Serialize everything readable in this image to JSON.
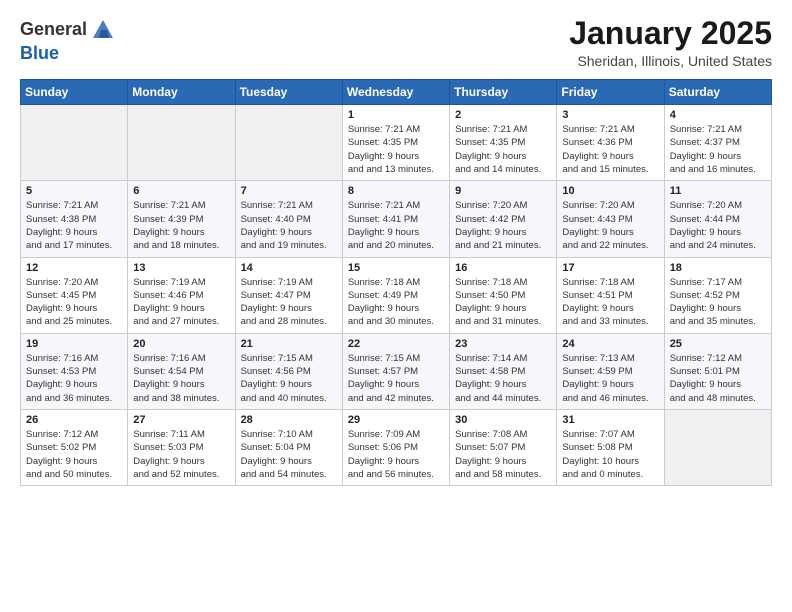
{
  "header": {
    "logo_general": "General",
    "logo_blue": "Blue",
    "month": "January 2025",
    "location": "Sheridan, Illinois, United States"
  },
  "weekdays": [
    "Sunday",
    "Monday",
    "Tuesday",
    "Wednesday",
    "Thursday",
    "Friday",
    "Saturday"
  ],
  "weeks": [
    [
      {
        "day": "",
        "info": ""
      },
      {
        "day": "",
        "info": ""
      },
      {
        "day": "",
        "info": ""
      },
      {
        "day": "1",
        "info": "Sunrise: 7:21 AM\nSunset: 4:35 PM\nDaylight: 9 hours and 13 minutes."
      },
      {
        "day": "2",
        "info": "Sunrise: 7:21 AM\nSunset: 4:35 PM\nDaylight: 9 hours and 14 minutes."
      },
      {
        "day": "3",
        "info": "Sunrise: 7:21 AM\nSunset: 4:36 PM\nDaylight: 9 hours and 15 minutes."
      },
      {
        "day": "4",
        "info": "Sunrise: 7:21 AM\nSunset: 4:37 PM\nDaylight: 9 hours and 16 minutes."
      }
    ],
    [
      {
        "day": "5",
        "info": "Sunrise: 7:21 AM\nSunset: 4:38 PM\nDaylight: 9 hours and 17 minutes."
      },
      {
        "day": "6",
        "info": "Sunrise: 7:21 AM\nSunset: 4:39 PM\nDaylight: 9 hours and 18 minutes."
      },
      {
        "day": "7",
        "info": "Sunrise: 7:21 AM\nSunset: 4:40 PM\nDaylight: 9 hours and 19 minutes."
      },
      {
        "day": "8",
        "info": "Sunrise: 7:21 AM\nSunset: 4:41 PM\nDaylight: 9 hours and 20 minutes."
      },
      {
        "day": "9",
        "info": "Sunrise: 7:20 AM\nSunset: 4:42 PM\nDaylight: 9 hours and 21 minutes."
      },
      {
        "day": "10",
        "info": "Sunrise: 7:20 AM\nSunset: 4:43 PM\nDaylight: 9 hours and 22 minutes."
      },
      {
        "day": "11",
        "info": "Sunrise: 7:20 AM\nSunset: 4:44 PM\nDaylight: 9 hours and 24 minutes."
      }
    ],
    [
      {
        "day": "12",
        "info": "Sunrise: 7:20 AM\nSunset: 4:45 PM\nDaylight: 9 hours and 25 minutes."
      },
      {
        "day": "13",
        "info": "Sunrise: 7:19 AM\nSunset: 4:46 PM\nDaylight: 9 hours and 27 minutes."
      },
      {
        "day": "14",
        "info": "Sunrise: 7:19 AM\nSunset: 4:47 PM\nDaylight: 9 hours and 28 minutes."
      },
      {
        "day": "15",
        "info": "Sunrise: 7:18 AM\nSunset: 4:49 PM\nDaylight: 9 hours and 30 minutes."
      },
      {
        "day": "16",
        "info": "Sunrise: 7:18 AM\nSunset: 4:50 PM\nDaylight: 9 hours and 31 minutes."
      },
      {
        "day": "17",
        "info": "Sunrise: 7:18 AM\nSunset: 4:51 PM\nDaylight: 9 hours and 33 minutes."
      },
      {
        "day": "18",
        "info": "Sunrise: 7:17 AM\nSunset: 4:52 PM\nDaylight: 9 hours and 35 minutes."
      }
    ],
    [
      {
        "day": "19",
        "info": "Sunrise: 7:16 AM\nSunset: 4:53 PM\nDaylight: 9 hours and 36 minutes."
      },
      {
        "day": "20",
        "info": "Sunrise: 7:16 AM\nSunset: 4:54 PM\nDaylight: 9 hours and 38 minutes."
      },
      {
        "day": "21",
        "info": "Sunrise: 7:15 AM\nSunset: 4:56 PM\nDaylight: 9 hours and 40 minutes."
      },
      {
        "day": "22",
        "info": "Sunrise: 7:15 AM\nSunset: 4:57 PM\nDaylight: 9 hours and 42 minutes."
      },
      {
        "day": "23",
        "info": "Sunrise: 7:14 AM\nSunset: 4:58 PM\nDaylight: 9 hours and 44 minutes."
      },
      {
        "day": "24",
        "info": "Sunrise: 7:13 AM\nSunset: 4:59 PM\nDaylight: 9 hours and 46 minutes."
      },
      {
        "day": "25",
        "info": "Sunrise: 7:12 AM\nSunset: 5:01 PM\nDaylight: 9 hours and 48 minutes."
      }
    ],
    [
      {
        "day": "26",
        "info": "Sunrise: 7:12 AM\nSunset: 5:02 PM\nDaylight: 9 hours and 50 minutes."
      },
      {
        "day": "27",
        "info": "Sunrise: 7:11 AM\nSunset: 5:03 PM\nDaylight: 9 hours and 52 minutes."
      },
      {
        "day": "28",
        "info": "Sunrise: 7:10 AM\nSunset: 5:04 PM\nDaylight: 9 hours and 54 minutes."
      },
      {
        "day": "29",
        "info": "Sunrise: 7:09 AM\nSunset: 5:06 PM\nDaylight: 9 hours and 56 minutes."
      },
      {
        "day": "30",
        "info": "Sunrise: 7:08 AM\nSunset: 5:07 PM\nDaylight: 9 hours and 58 minutes."
      },
      {
        "day": "31",
        "info": "Sunrise: 7:07 AM\nSunset: 5:08 PM\nDaylight: 10 hours and 0 minutes."
      },
      {
        "day": "",
        "info": ""
      }
    ]
  ]
}
